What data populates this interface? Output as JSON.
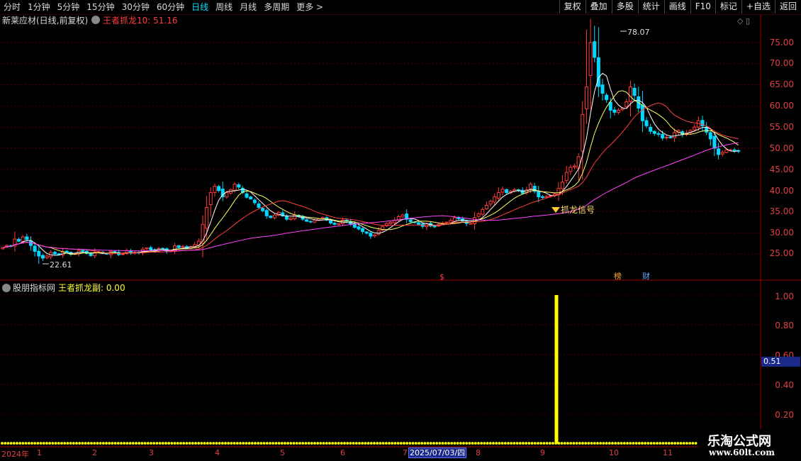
{
  "toolbar": {
    "periods": [
      "分时",
      "1分钟",
      "5分钟",
      "15分钟",
      "30分钟",
      "60分钟",
      "日线",
      "周线",
      "月线",
      "多周期",
      "更多 >"
    ],
    "active_period": "日线",
    "buttons": [
      "复权",
      "叠加",
      "多股",
      "统计",
      "画线",
      "F10",
      "标记",
      "+自选",
      "返回"
    ]
  },
  "main_pane": {
    "stock_title": "新莱应材(日线,前复权)",
    "indicator_label": "王者抓龙10: 51.16",
    "high_marker": "78.07",
    "low_marker": "22.61",
    "signal_label": "抓龙信号",
    "event_markers": [
      "$",
      "榜",
      "财"
    ],
    "price_axis": [
      "75.00",
      "70.00",
      "65.00",
      "60.00",
      "55.00",
      "50.00",
      "45.00",
      "40.00",
      "35.00",
      "30.00",
      "25.00"
    ]
  },
  "sub_pane": {
    "title": "股朋指标网",
    "indicator_label": "王者抓龙副: 0.00",
    "value_axis": [
      "1.00",
      "0.80",
      "0.60",
      "0.40",
      "0.20"
    ],
    "cursor_value": "0.51"
  },
  "date_axis": {
    "labels": [
      "2024年",
      "1",
      "2",
      "3",
      "4",
      "5",
      "6",
      "7",
      "8",
      "9",
      "10",
      "11"
    ],
    "highlight": "2025/07/03/四"
  },
  "watermark": {
    "line1": "乐淘公式网",
    "line2": "www.60lt.com"
  },
  "colors": {
    "up": "#ff3b3b",
    "down": "#00d8ff",
    "ma5": "#ffffff",
    "ma10": "#ffff66",
    "ma20": "#ff4040",
    "ma60": "#ff44ff",
    "signal": "#ffff00"
  },
  "chart_data": {
    "type": "candlestick",
    "ylim": [
      20,
      80
    ],
    "closes": [
      26.5,
      27,
      26.8,
      28.5,
      28,
      29,
      28.4,
      27,
      25.6,
      24.5,
      24,
      24.5,
      25.3,
      25,
      24.8,
      25.6,
      25.4,
      24.9,
      25.1,
      25.8,
      25.6,
      25.1,
      24.6,
      25.4,
      25.5,
      25.1,
      25,
      25.6,
      25.4,
      24.8,
      25,
      25.8,
      25.2,
      25.4,
      25.2,
      26.1,
      26.4,
      26,
      25.6,
      26.3,
      26.1,
      25.6,
      25.8,
      26.9,
      26.5,
      26.8,
      26.3,
      26.7,
      27.2,
      28,
      32,
      36,
      39.5,
      41,
      40,
      38.5,
      39.5,
      40.2,
      41.5,
      40.8,
      39.5,
      38.4,
      38,
      37.1,
      36,
      35.2,
      34,
      33.6,
      34.2,
      34.8,
      34,
      33.2,
      33.5,
      34.2,
      33.9,
      33.2,
      32.7,
      32.6,
      33,
      33.3,
      33.6,
      33,
      32.3,
      32,
      32.2,
      33,
      32.7,
      32.1,
      31.3,
      30.9,
      30.3,
      29.9,
      29.2,
      29.5,
      30.5,
      31.5,
      32.2,
      32.5,
      33,
      33.8,
      34.2,
      33.2,
      32.6,
      32.4,
      32,
      31.5,
      32.2,
      31.6,
      31.4,
      32,
      32.3,
      32.5,
      32.9,
      33.6,
      33.3,
      32.8,
      32.2,
      32.2,
      33.6,
      34.5,
      35.5,
      36.5,
      37.5,
      38.5,
      39.5,
      40.3,
      39.5,
      39.8,
      40.2,
      40.1,
      39.3,
      40.2,
      41.5,
      39.8,
      38.5,
      38.4,
      38.6,
      38.8,
      39.2,
      40.5,
      42,
      44.3,
      45.5,
      45.8,
      48,
      58,
      64.5,
      75,
      71.5,
      64.6,
      63,
      61.5,
      59,
      58.5,
      59,
      59.5,
      61,
      64.5,
      62.5,
      59.5,
      56.5,
      55.3,
      54,
      53.5,
      53.3,
      52.4,
      52.6,
      52.5,
      53.7,
      54.2,
      53.2,
      53.6,
      54.2,
      55,
      56.5,
      55.3,
      53.8,
      52.2,
      50,
      48.5,
      49,
      49.6,
      49.6,
      49.5,
      49.3
    ],
    "high": 78.07,
    "low": 22.61,
    "signal": {
      "index": 130,
      "value": 1.0
    },
    "sub_ylim": [
      0,
      1.05
    ]
  }
}
